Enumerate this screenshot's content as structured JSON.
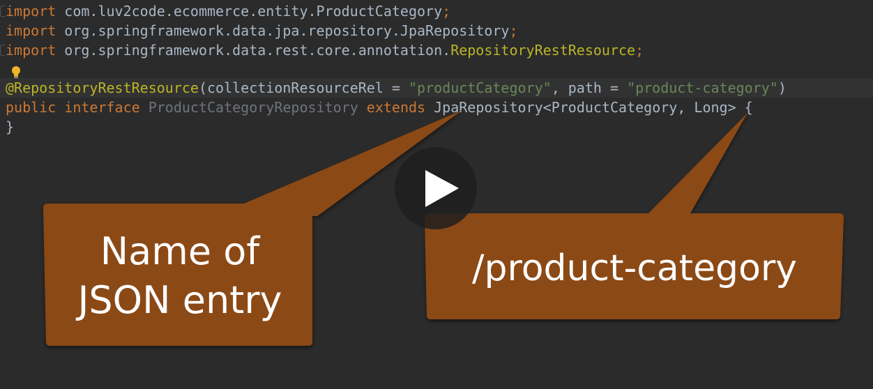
{
  "code": {
    "line1": {
      "kw": "import",
      "pkg": " com.luv2code.ecommerce.entity.ProductCategory",
      "semi": ";"
    },
    "line2": {
      "kw": "import",
      "pkg": " org.springframework.data.jpa.repository.JpaRepository",
      "semi": ";"
    },
    "line3": {
      "kw": "import",
      "pkg": " org.springframework.data.rest.core.annotation.",
      "cls": "RepositoryRestResource",
      "semi": ";"
    },
    "line4": {
      "ann": "@RepositoryRestResource",
      "open": "(collectionResourceRel = ",
      "str1": "\"productCategory\"",
      "mid": ", path = ",
      "str2": "\"product-category\"",
      "close": ")"
    },
    "line5": {
      "kw1": "public",
      "kw2": "interface",
      "iface": "ProductCategoryRepository",
      "kw3": "extends",
      "rest": " JpaRepository<ProductCategory, Long> {"
    },
    "line6": {
      "brace": "}"
    }
  },
  "callouts": {
    "left_line1": "Name of",
    "left_line2": "JSON entry",
    "right": "/product-category"
  },
  "colors": {
    "background": "#2b2b2b",
    "keyword": "#cc7832",
    "annotation": "#bbb529",
    "string": "#6a8759",
    "callout": "#8b4a16"
  },
  "icons": {
    "bulb": "lightbulb-icon",
    "play": "play-icon"
  }
}
